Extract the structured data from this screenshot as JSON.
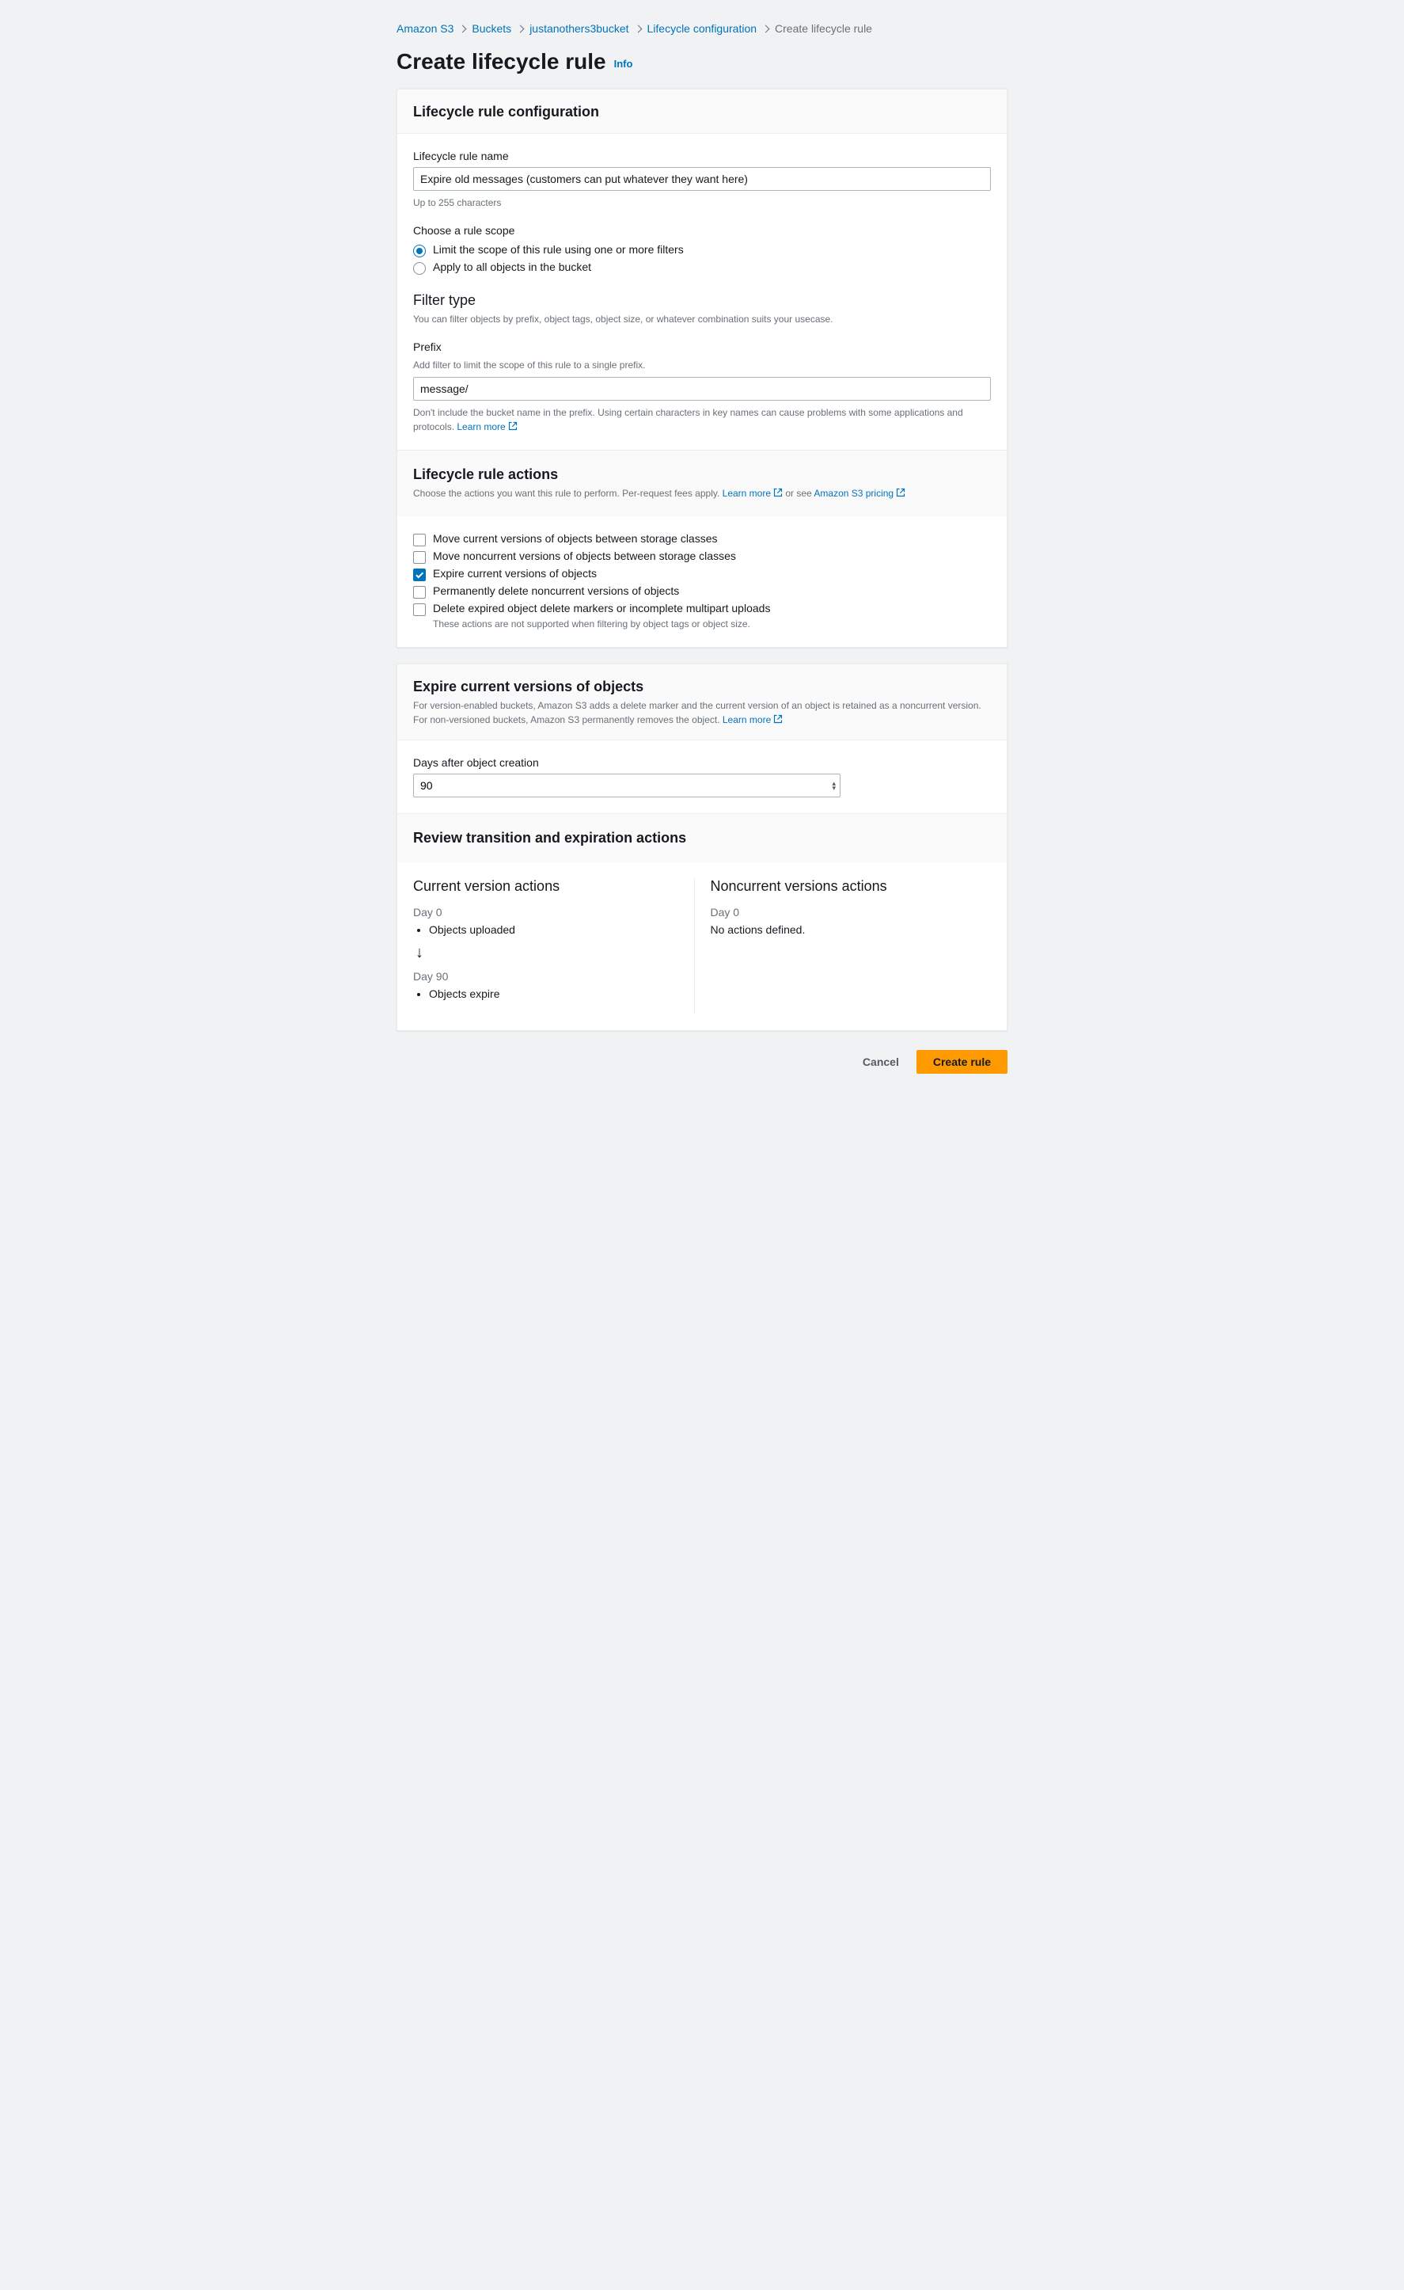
{
  "breadcrumb": {
    "items": [
      "Amazon S3",
      "Buckets",
      "justanothers3bucket",
      "Lifecycle configuration"
    ],
    "current": "Create lifecycle rule"
  },
  "page": {
    "title": "Create lifecycle rule",
    "info_label": "Info"
  },
  "config": {
    "panel_title": "Lifecycle rule configuration",
    "name_label": "Lifecycle rule name",
    "name_value": "Expire old messages (customers can put whatever they want here)",
    "name_hint": "Up to 255 characters",
    "scope_label": "Choose a rule scope",
    "scope_options": [
      {
        "label": "Limit the scope of this rule using one or more filters",
        "selected": true
      },
      {
        "label": "Apply to all objects in the bucket",
        "selected": false
      }
    ],
    "filter_title": "Filter type",
    "filter_desc": "You can filter objects by prefix, object tags, object size, or whatever combination suits your usecase.",
    "prefix_label": "Prefix",
    "prefix_sublabel": "Add filter to limit the scope of this rule to a single prefix.",
    "prefix_value": "message/",
    "prefix_hint_pre": "Don't include the bucket name in the prefix. Using certain characters in key names can cause problems with some applications and protocols. ",
    "learn_more": "Learn more"
  },
  "actions": {
    "panel_title": "Lifecycle rule actions",
    "desc_pre": "Choose the actions you want this rule to perform. Per-request fees apply. ",
    "learn_more": "Learn more",
    "mid_text": " or see ",
    "pricing_link": "Amazon S3 pricing",
    "items": [
      {
        "label": "Move current versions of objects between storage classes",
        "checked": false
      },
      {
        "label": "Move noncurrent versions of objects between storage classes",
        "checked": false
      },
      {
        "label": "Expire current versions of objects",
        "checked": true
      },
      {
        "label": "Permanently delete noncurrent versions of objects",
        "checked": false
      },
      {
        "label": "Delete expired object delete markers or incomplete multipart uploads",
        "checked": false,
        "sub": "These actions are not supported when filtering by object tags or object size."
      }
    ]
  },
  "expire": {
    "panel_title": "Expire current versions of objects",
    "desc_pre": "For version-enabled buckets, Amazon S3 adds a delete marker and the current version of an object is retained as a noncurrent version. For non-versioned buckets, Amazon S3 permanently removes the object. ",
    "learn_more": "Learn more",
    "days_label": "Days after object creation",
    "days_value": "90"
  },
  "review": {
    "panel_title": "Review transition and expiration actions",
    "current_title": "Current version actions",
    "noncurrent_title": "Noncurrent versions actions",
    "day0": "Day 0",
    "uploaded": "Objects uploaded",
    "day90": "Day 90",
    "expire": "Objects expire",
    "none": "No actions defined."
  },
  "footer": {
    "cancel": "Cancel",
    "create": "Create rule"
  }
}
